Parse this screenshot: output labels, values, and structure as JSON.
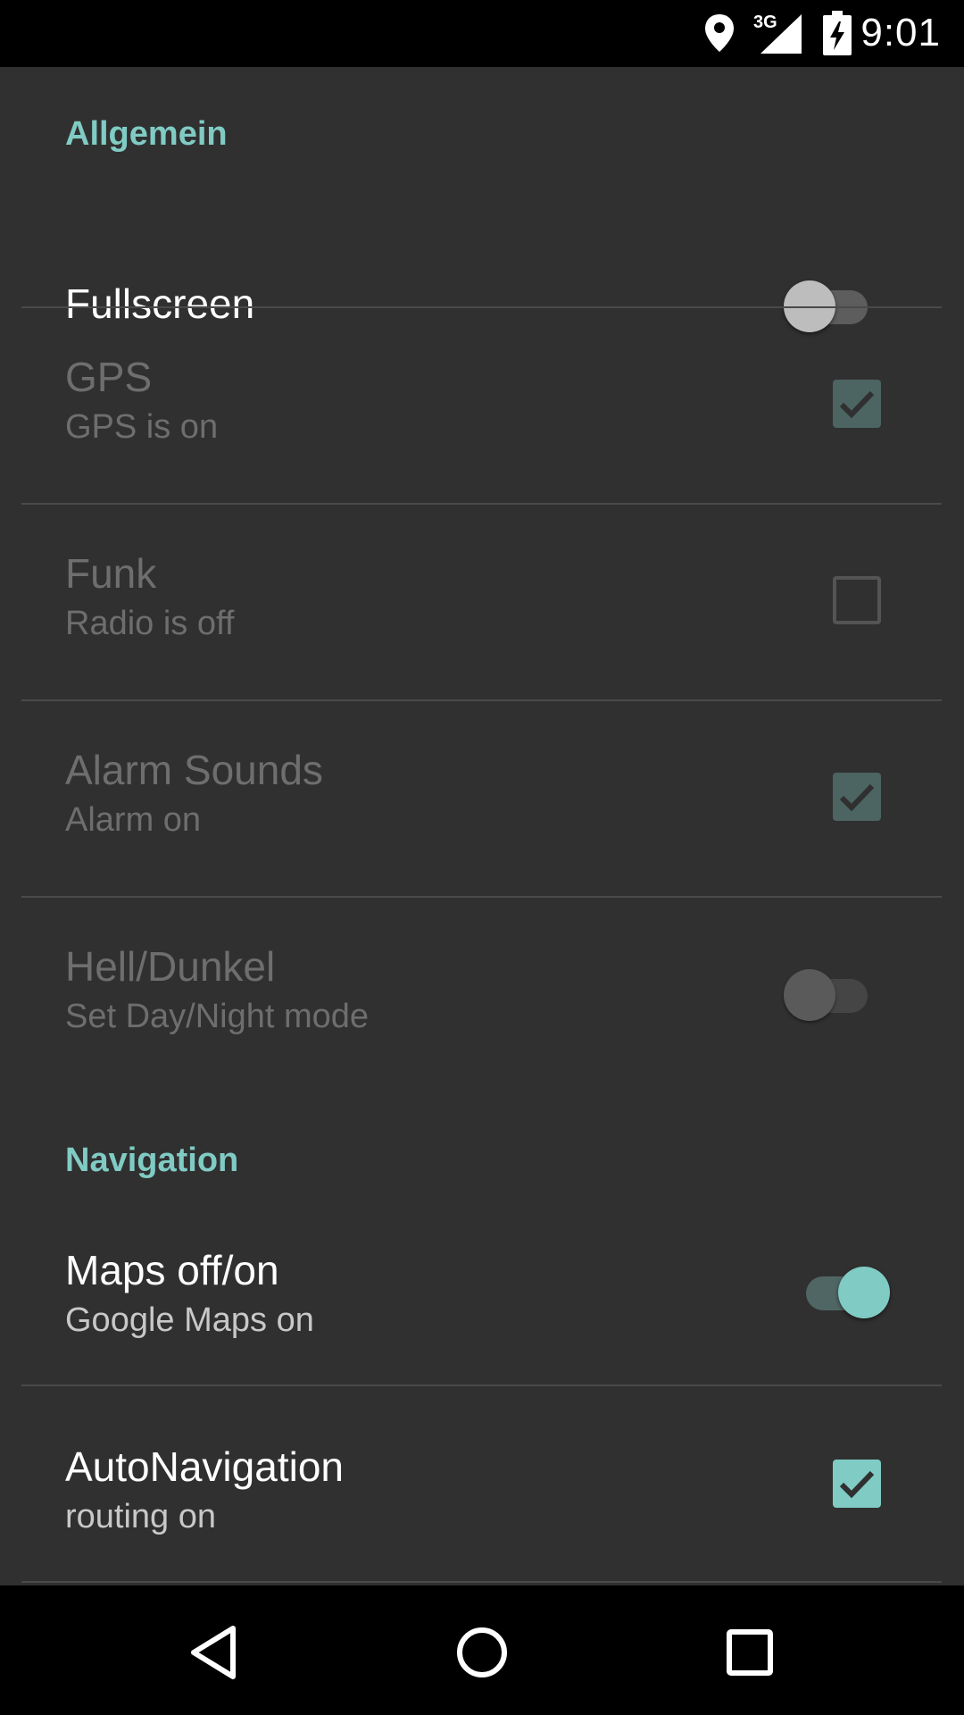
{
  "status_bar": {
    "time": "9:01",
    "network_label": "3G",
    "icons": [
      "location-pin-icon",
      "signal-icon",
      "battery-charging-icon"
    ]
  },
  "sections": [
    {
      "header": "Allgemein",
      "items": [
        {
          "title": "Fullscreen",
          "summary": "",
          "control": "switch",
          "state": "off",
          "enabled": true
        },
        {
          "title": "GPS",
          "summary": "GPS is on",
          "control": "checkbox",
          "state": "checked",
          "enabled": false
        },
        {
          "title": "Funk",
          "summary": "Radio is off",
          "control": "checkbox",
          "state": "unchecked",
          "enabled": false
        },
        {
          "title": "Alarm Sounds",
          "summary": "Alarm on",
          "control": "checkbox",
          "state": "checked",
          "enabled": false
        },
        {
          "title": "Hell/Dunkel",
          "summary": "Set Day/Night mode",
          "control": "switch",
          "state": "off",
          "enabled": false
        }
      ]
    },
    {
      "header": "Navigation",
      "items": [
        {
          "title": "Maps off/on",
          "summary": "Google Maps on",
          "control": "switch",
          "state": "on",
          "enabled": true
        },
        {
          "title": "AutoNavigation",
          "summary": "routing on",
          "control": "checkbox",
          "state": "checked",
          "enabled": true
        }
      ]
    }
  ],
  "nav_bar": {
    "buttons": [
      "back-icon",
      "home-icon",
      "recents-icon"
    ]
  },
  "colors": {
    "accent": "#80cbc4",
    "background": "#303030",
    "bars": "#000000"
  }
}
